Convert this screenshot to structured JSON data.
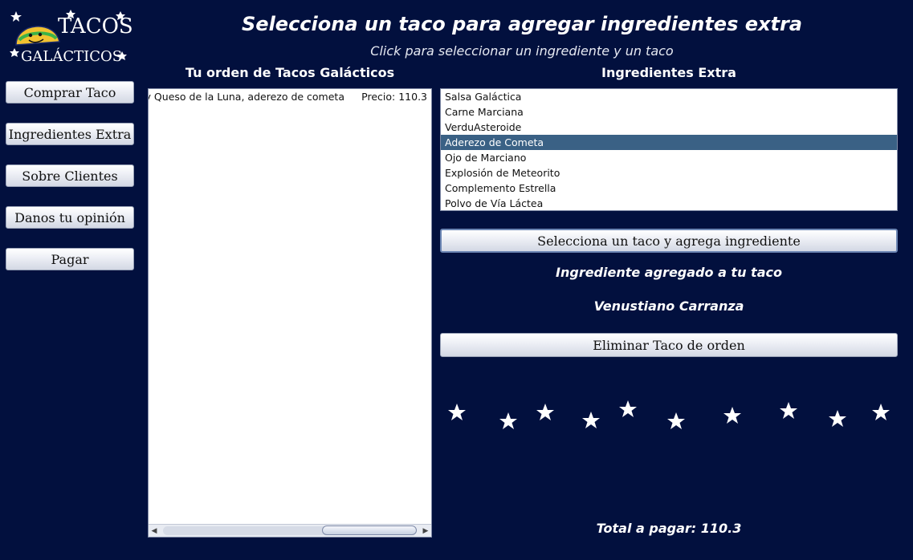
{
  "logo": {
    "line1": "TACOS",
    "line2": "GALÁCTICOS"
  },
  "sidebar": {
    "buttons": [
      {
        "label": "Comprar Taco"
      },
      {
        "label": "Ingredientes Extra"
      },
      {
        "label": "Sobre Clientes"
      },
      {
        "label": "Danos tu opinión"
      },
      {
        "label": "Pagar"
      }
    ]
  },
  "header": {
    "title": "Selecciona un taco para agregar ingredientes extra",
    "subtitle": "Click para seleccionar un ingrediente y un taco"
  },
  "order": {
    "title": "Tu orden de Tacos Galácticos",
    "items": [
      {
        "description": "y Queso de la Luna, aderezo de cometa",
        "price": "Precio: 110.3"
      }
    ]
  },
  "ingredients": {
    "title": "Ingredientes Extra",
    "items": [
      "Salsa Galáctica",
      "Carne Marciana",
      "VerduAsteroide",
      "Aderezo de Cometa",
      "Ojo de Marciano",
      "Explosión de Meteorito",
      "Complemento Estrella",
      "Polvo de Vía Láctea"
    ],
    "selected_index": 3
  },
  "actions": {
    "add_label": "Selecciona un taco y agrega ingrediente",
    "status": "Ingrediente agregado a tu taco",
    "customer": "Venustiano Carranza",
    "remove_label": "Eliminar Taco de orden"
  },
  "footer": {
    "total": "Total a pagar: 110.3"
  },
  "colors": {
    "background": "#02103e",
    "selection": "#3a6185",
    "accent": "#6c86b4"
  }
}
